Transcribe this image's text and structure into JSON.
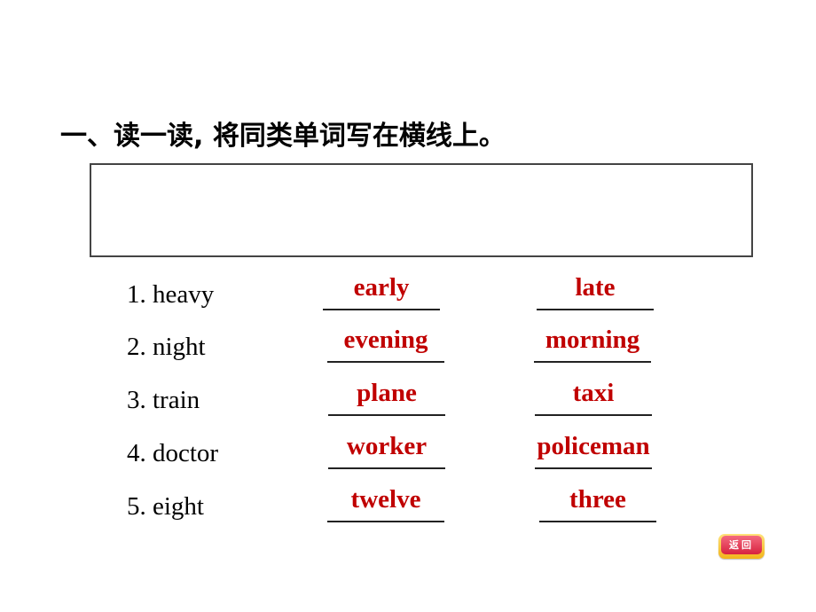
{
  "title": "一、读一读, 将同类单词写在横线上。",
  "colors": {
    "answer": "#c00000",
    "text": "#000000"
  },
  "rows": [
    {
      "word": "1. heavy",
      "answers": [
        "early",
        "late"
      ]
    },
    {
      "word": "2. night",
      "answers": [
        "evening",
        "morning"
      ]
    },
    {
      "word": "3. train",
      "answers": [
        "plane",
        "taxi"
      ]
    },
    {
      "word": "4. doctor",
      "answers": [
        "worker",
        "policeman"
      ]
    },
    {
      "word": "5. eight",
      "answers": [
        "twelve",
        "three"
      ]
    }
  ],
  "back_button": {
    "label": "返回"
  }
}
